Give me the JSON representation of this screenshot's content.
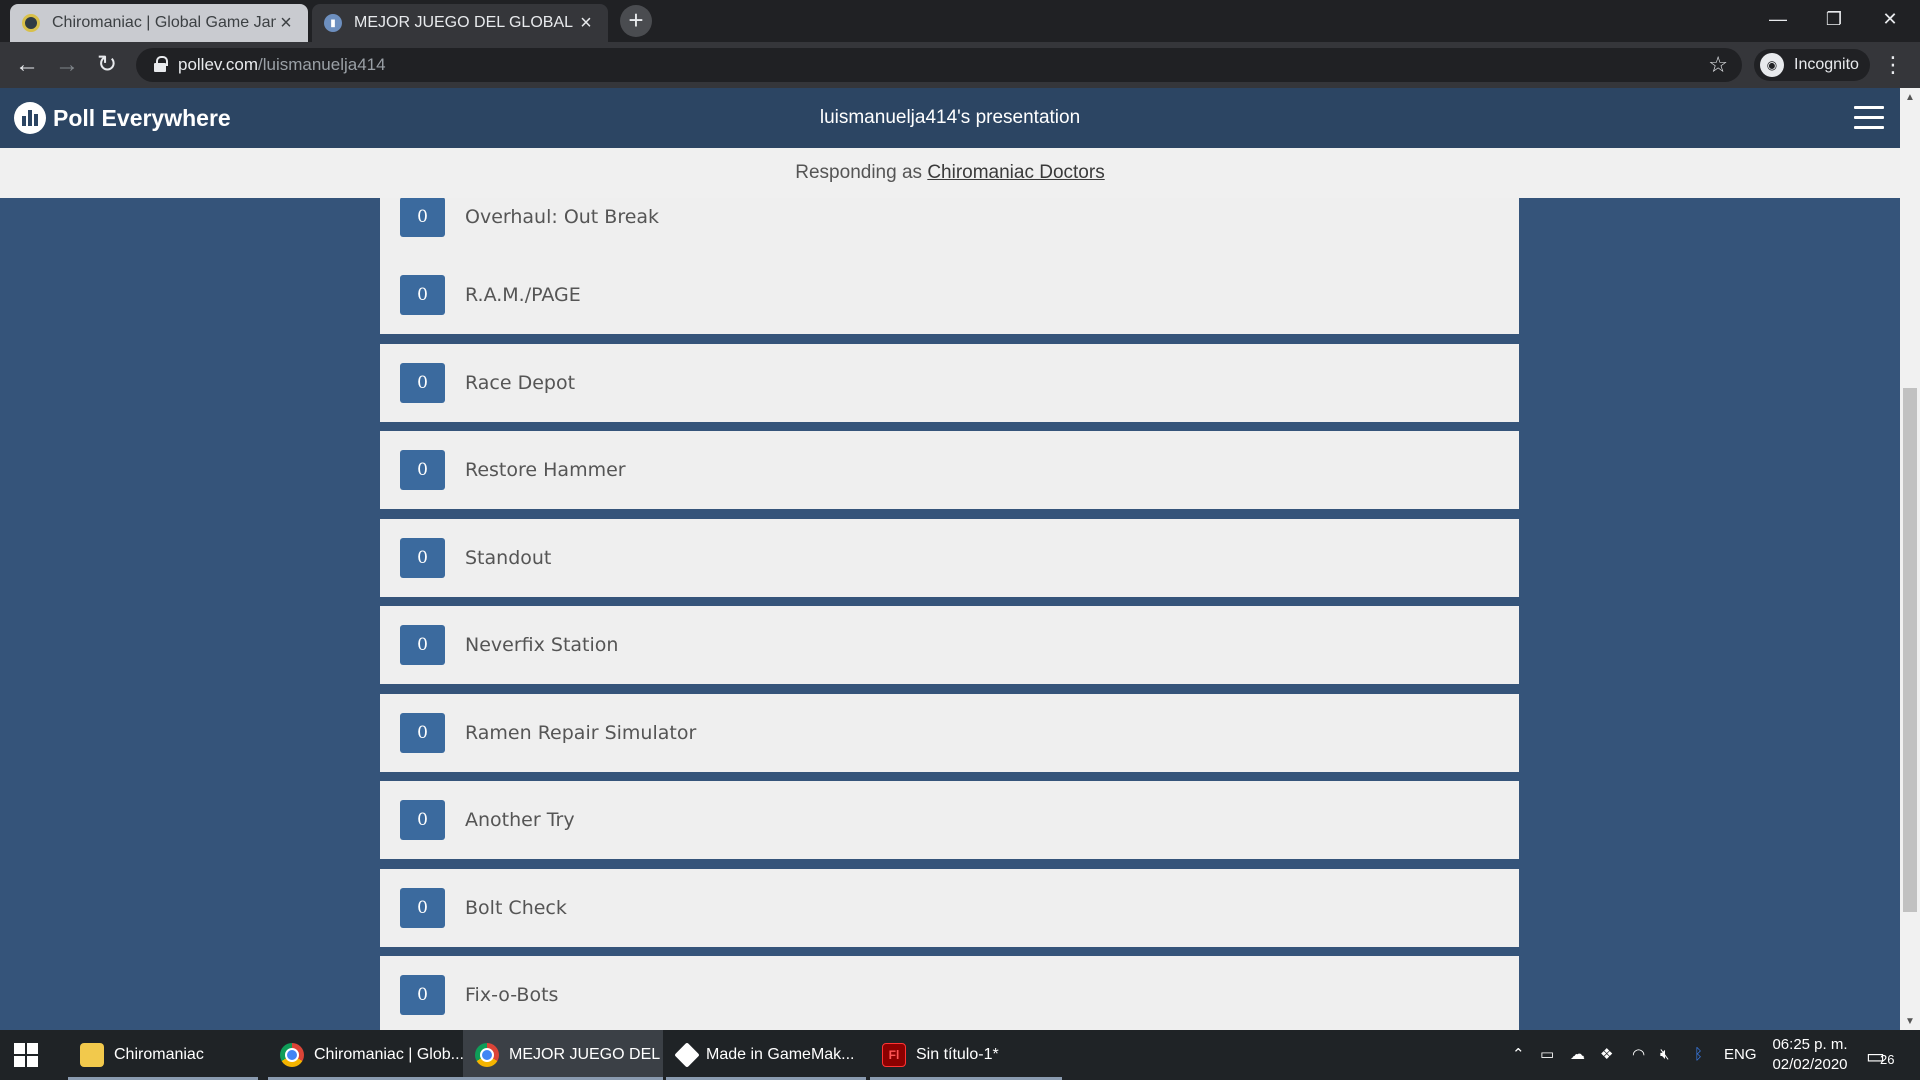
{
  "browser": {
    "tabs": [
      {
        "title": "Chiromaniac | Global Game Jam",
        "active": false
      },
      {
        "title": "MEJOR JUEGO DEL GLOBAL GAME JAM",
        "active": true
      }
    ],
    "new_tab": "+",
    "url_host": "pollev.com",
    "url_path": "/luismanuelja414",
    "profile_label": "Incognito"
  },
  "app": {
    "brand": "Poll Everywhere",
    "presentation_title": "luismanuelja414's presentation",
    "responding_prefix": "Responding as ",
    "responding_name": "Chiromaniac Doctors"
  },
  "options": [
    {
      "count": "0",
      "label": "Overhaul: Out Break"
    },
    {
      "count": "0",
      "label": "R.A.M./PAGE"
    },
    {
      "count": "0",
      "label": "Race Depot"
    },
    {
      "count": "0",
      "label": "Restore Hammer"
    },
    {
      "count": "0",
      "label": "Standout"
    },
    {
      "count": "0",
      "label": "Neverfix Station"
    },
    {
      "count": "0",
      "label": "Ramen Repair Simulator"
    },
    {
      "count": "0",
      "label": "Another Try"
    },
    {
      "count": "0",
      "label": "Bolt Check"
    },
    {
      "count": "0",
      "label": "Fix-o-Bots"
    }
  ],
  "taskbar": {
    "items": [
      {
        "label": "Chiromaniac",
        "icon": "folder-icon"
      },
      {
        "label": "Chiromaniac | Glob...",
        "icon": "chrome-icon"
      },
      {
        "label": "MEJOR JUEGO DEL ...",
        "icon": "chrome-icon"
      },
      {
        "label": "Made in GameMak...",
        "icon": "gamemaker-icon"
      },
      {
        "label": "Sin título-1*",
        "icon": "flash-icon"
      }
    ],
    "language": "ENG",
    "time": "06:25 p. m.",
    "date": "02/02/2020",
    "notification_count": "26",
    "flash_icon_text": "Fl"
  },
  "colors": {
    "page_background": "#35547a",
    "header_background": "#2c4563",
    "count_badge": "#3b6a9e",
    "option_background": "#efefef"
  }
}
